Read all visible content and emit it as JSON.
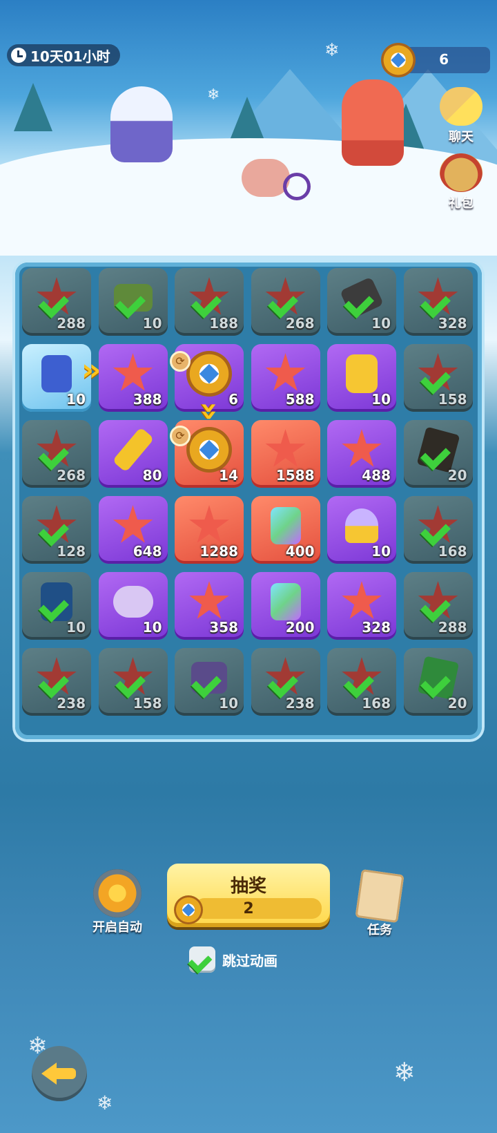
{
  "hud": {
    "timer": "10天01小时",
    "currency_value": "6"
  },
  "side": {
    "chat_label": "聊天",
    "gift_label": "礼包"
  },
  "board": {
    "tiles": [
      {
        "kind": "stone",
        "item": "starfish",
        "claimed": true,
        "count": "288"
      },
      {
        "kind": "stone",
        "item": "green-ore",
        "claimed": true,
        "count": "10"
      },
      {
        "kind": "stone",
        "item": "starfish",
        "claimed": true,
        "count": "188"
      },
      {
        "kind": "stone",
        "item": "starfish",
        "claimed": true,
        "count": "268"
      },
      {
        "kind": "stone",
        "item": "iron-chunk",
        "claimed": true,
        "count": "10"
      },
      {
        "kind": "stone",
        "item": "starfish",
        "claimed": true,
        "count": "328"
      },
      {
        "kind": "ice",
        "item": "blue-crystal",
        "claimed": false,
        "count": "10"
      },
      {
        "kind": "purple",
        "item": "starfish",
        "claimed": false,
        "count": "388"
      },
      {
        "kind": "purple",
        "item": "compass",
        "claimed": false,
        "count": "6"
      },
      {
        "kind": "purple",
        "item": "starfish",
        "claimed": false,
        "count": "588"
      },
      {
        "kind": "purple",
        "item": "gold-statue",
        "claimed": false,
        "count": "10"
      },
      {
        "kind": "stone",
        "item": "starfish",
        "claimed": true,
        "count": "158"
      },
      {
        "kind": "stone",
        "item": "starfish",
        "claimed": true,
        "count": "268"
      },
      {
        "kind": "purple",
        "item": "golden-key",
        "claimed": false,
        "count": "80"
      },
      {
        "kind": "red",
        "item": "compass",
        "claimed": false,
        "count": "14"
      },
      {
        "kind": "red",
        "item": "starfish",
        "claimed": false,
        "count": "1588"
      },
      {
        "kind": "purple",
        "item": "starfish",
        "claimed": false,
        "count": "488"
      },
      {
        "kind": "stone",
        "item": "dark-slab",
        "claimed": true,
        "count": "20"
      },
      {
        "kind": "stone",
        "item": "starfish",
        "claimed": true,
        "count": "128"
      },
      {
        "kind": "purple",
        "item": "starfish",
        "claimed": false,
        "count": "648"
      },
      {
        "kind": "red",
        "item": "starfish",
        "claimed": false,
        "count": "1288"
      },
      {
        "kind": "red",
        "item": "rainbow-gem",
        "claimed": false,
        "count": "400"
      },
      {
        "kind": "purple",
        "item": "orb-chest",
        "claimed": false,
        "count": "10"
      },
      {
        "kind": "stone",
        "item": "starfish",
        "claimed": true,
        "count": "168"
      },
      {
        "kind": "stone",
        "item": "blue-ore",
        "claimed": true,
        "count": "10"
      },
      {
        "kind": "purple",
        "item": "candy-bag",
        "claimed": false,
        "count": "10"
      },
      {
        "kind": "purple",
        "item": "starfish",
        "claimed": false,
        "count": "358"
      },
      {
        "kind": "purple",
        "item": "rainbow-gem",
        "claimed": false,
        "count": "200"
      },
      {
        "kind": "purple",
        "item": "starfish",
        "claimed": false,
        "count": "328"
      },
      {
        "kind": "stone",
        "item": "starfish",
        "claimed": true,
        "count": "288"
      },
      {
        "kind": "stone",
        "item": "starfish",
        "claimed": true,
        "count": "238"
      },
      {
        "kind": "stone",
        "item": "starfish",
        "claimed": true,
        "count": "158"
      },
      {
        "kind": "stone",
        "item": "amethyst-rock",
        "claimed": true,
        "count": "10"
      },
      {
        "kind": "stone",
        "item": "starfish",
        "claimed": true,
        "count": "238"
      },
      {
        "kind": "stone",
        "item": "starfish",
        "claimed": true,
        "count": "168"
      },
      {
        "kind": "stone",
        "item": "green-slab",
        "claimed": true,
        "count": "20"
      }
    ]
  },
  "controls": {
    "auto_label": "开启自动",
    "draw_title": "抽奖",
    "draw_count": "2",
    "task_label": "任务",
    "skip_label": "跳过动画",
    "skip_checked": true
  },
  "colors": {
    "stone": "#4e6f78",
    "purple": "#9a52e6",
    "red": "#f06a52",
    "ice": "#8fd3f2",
    "check": "#3ed03c",
    "gold": "#ffd84a"
  }
}
